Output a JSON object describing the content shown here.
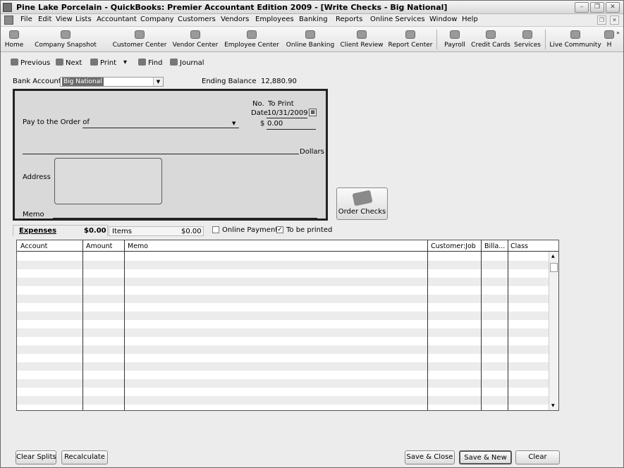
{
  "window": {
    "title": "Pine Lake Porcelain  - QuickBooks: Premier Accountant Edition 2009 - [Write Checks - Big National]"
  },
  "menu": [
    "File",
    "Edit",
    "View",
    "Lists",
    "Accountant",
    "Company",
    "Customers",
    "Vendors",
    "Employees",
    "Banking",
    "Reports",
    "Online Services",
    "Window",
    "Help"
  ],
  "iconbar": [
    "Home",
    "Company Snapshot",
    "Customer Center",
    "Vendor Center",
    "Employee Center",
    "Online Banking",
    "Client Review",
    "Report Center",
    "Payroll",
    "Credit Cards",
    "Services",
    "Live Community",
    "H"
  ],
  "toolbar": {
    "previous": "Previous",
    "next": "Next",
    "print": "Print",
    "find": "Find",
    "journal": "Journal"
  },
  "form": {
    "bank_account_label": "Bank Account",
    "bank_account_value": "Big National",
    "ending_balance_label": "Ending Balance",
    "ending_balance_value": "12,880.90"
  },
  "check": {
    "no_label": "No.",
    "no_value": "To Print",
    "date_label": "Date",
    "date_value": "10/31/2009",
    "pay_to_label": "Pay to the Order of",
    "dollar_sign": "$",
    "amount_value": "0.00",
    "dollars_label": "Dollars",
    "address_label": "Address",
    "memo_label": "Memo"
  },
  "order_checks_label": "Order Checks",
  "tabs": {
    "expenses_label": "Expenses",
    "expenses_amount": "$0.00",
    "items_label": "Items",
    "items_amount": "$0.00"
  },
  "options": {
    "online_payment": "Online Payment",
    "to_be_printed": "To be printed",
    "to_be_printed_checked": true
  },
  "grid": {
    "columns": [
      "Account",
      "Amount",
      "Memo",
      "Customer:Job",
      "Billa...",
      "Class"
    ]
  },
  "buttons": {
    "clear_splits": "Clear Splits",
    "recalculate": "Recalculate",
    "save_close": "Save & Close",
    "save_new": "Save & New",
    "clear": "Clear"
  }
}
